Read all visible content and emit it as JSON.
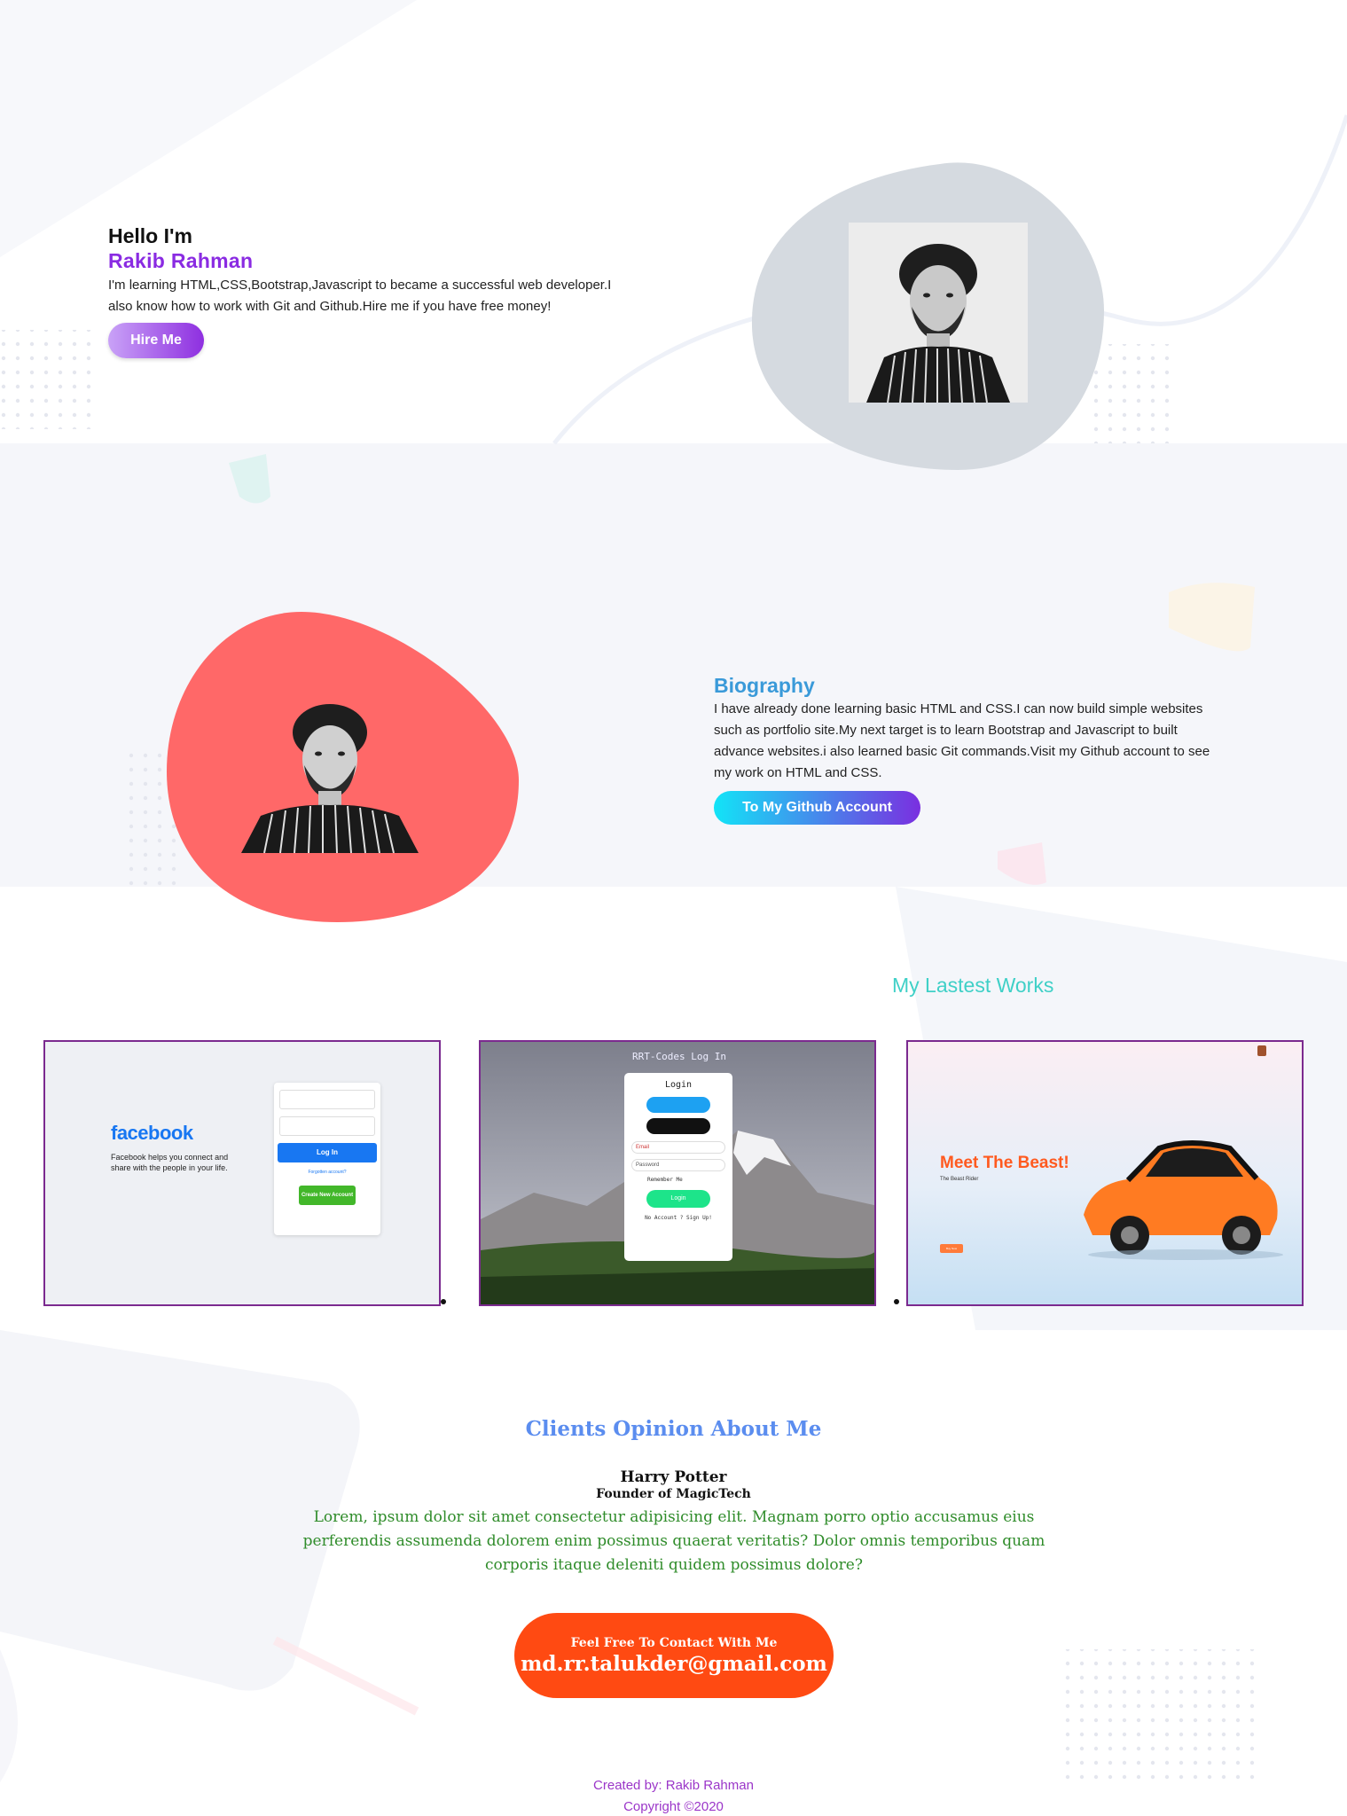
{
  "hero": {
    "greeting": "Hello I'm",
    "name": "Rakib Rahman",
    "description": "I'm learning HTML,CSS,Bootstrap,Javascript to became a successful web developer.I also know how to work with Git and Github.Hire me if you have free money!",
    "hire_button": "Hire Me",
    "photo_icon": "portrait-photo"
  },
  "biography": {
    "title": "Biography",
    "description": "I have already done learning basic HTML and CSS.I can now build simple websites such as portfolio site.My next target is to learn Bootstrap and Javascript to built advance websites.i also learned basic Git commands.Visit my Github account to see my work on HTML and CSS.",
    "github_button": "To My Github Account"
  },
  "works": {
    "title": "My Lastest Works",
    "items": [
      {
        "logo": "facebook",
        "tagline": "Facebook helps you connect and share with the people in your life.",
        "login_button": "Log In",
        "forgot_link": "Forgotten account?",
        "create_button": "Create New Account"
      },
      {
        "page_title": "RRT-Codes Log In",
        "card_title": "Login",
        "email_label": "Email",
        "password_label": "Password",
        "remember": "Remember Me",
        "login_button": "Login",
        "signup_text": "No Account ? Sign Up!"
      },
      {
        "headline": "Meet The Beast!",
        "subtitle": "The Beast Rider",
        "button": "Buy Now"
      }
    ]
  },
  "clients": {
    "title": "Clients Opinion About Me",
    "name": "Harry Potter",
    "role": "Founder of MagicTech",
    "quote": "Lorem, ipsum dolor sit amet consectetur adipisicing elit. Magnam porro optio accusamus eius perferendis assumenda dolorem enim possimus quaerat veritatis? Dolor omnis temporibus quam corporis itaque deleniti quidem possimus dolore?"
  },
  "contact": {
    "label": "Feel Free To Contact With Me",
    "email": "md.rr.talukder@gmail.com"
  },
  "footer": {
    "created_by": "Created by: Rakib Rahman",
    "copyright": "Copyright ©2020"
  },
  "colors": {
    "accent_purple": "#8a2be2",
    "bio_blue": "#3a9ad9",
    "works_teal": "#3fd0c7",
    "contact_orange": "#ff4a12",
    "blob_gray": "#d5dae0",
    "blob_red": "#ff6868"
  }
}
